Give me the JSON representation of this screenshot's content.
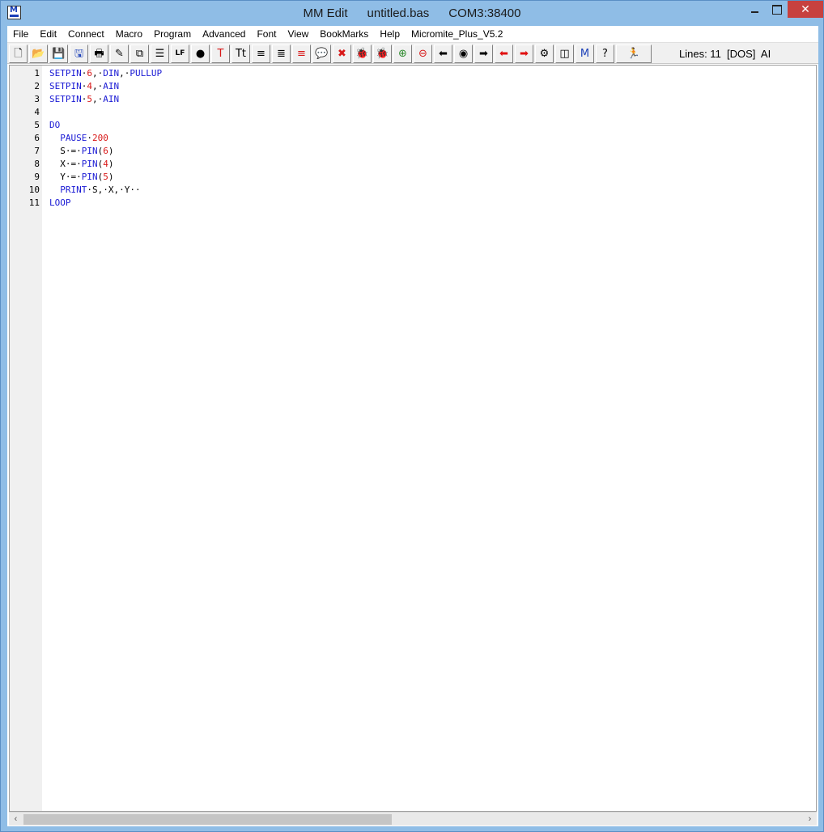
{
  "window": {
    "title_app": "MM Edit",
    "title_file": "untitled.bas",
    "title_port": "COM3:38400",
    "close_glyph": "✕"
  },
  "menu": [
    "File",
    "Edit",
    "Connect",
    "Macro",
    "Program",
    "Advanced",
    "Font",
    "View",
    "BookMarks",
    "Help",
    "Micromite_Plus_V5.2"
  ],
  "toolbar": {
    "buttons": [
      {
        "icon": "new-file-icon",
        "glyph": "🗋"
      },
      {
        "icon": "open-folder-icon",
        "glyph": "📂"
      },
      {
        "icon": "save-icon",
        "glyph": "💾"
      },
      {
        "icon": "save-as-icon",
        "glyph": "🖫"
      },
      {
        "icon": "print-icon",
        "glyph": "🖶"
      },
      {
        "icon": "highlighter-icon",
        "glyph": "✎"
      },
      {
        "icon": "copy-icon",
        "glyph": "⧉"
      },
      {
        "icon": "list-icon",
        "glyph": "☰"
      },
      {
        "icon": "lf-icon",
        "glyph": "LF"
      },
      {
        "icon": "dot-icon",
        "glyph": "●"
      },
      {
        "icon": "red-text-icon",
        "glyph": "T"
      },
      {
        "icon": "text-case-icon",
        "glyph": "Tt"
      },
      {
        "icon": "align-left-icon",
        "glyph": "≡"
      },
      {
        "icon": "align-right-icon",
        "glyph": "≣"
      },
      {
        "icon": "red-indent-icon",
        "glyph": "≡"
      },
      {
        "icon": "comment-bubble-icon",
        "glyph": "💬"
      },
      {
        "icon": "remove-comment-icon",
        "glyph": "✖"
      },
      {
        "icon": "bug-green-icon",
        "glyph": "🐞"
      },
      {
        "icon": "bug-red-icon",
        "glyph": "🐞"
      },
      {
        "icon": "add-bookmark-icon",
        "glyph": "⊕"
      },
      {
        "icon": "remove-bookmark-icon",
        "glyph": "⊖"
      },
      {
        "icon": "arrow-left-icon",
        "glyph": "⬅"
      },
      {
        "icon": "target-icon",
        "glyph": "◉"
      },
      {
        "icon": "arrow-right-icon",
        "glyph": "➡"
      },
      {
        "icon": "red-arrow-left-icon",
        "glyph": "⬅"
      },
      {
        "icon": "red-arrow-right-icon",
        "glyph": "➡"
      },
      {
        "icon": "gear-icon",
        "glyph": "⚙"
      },
      {
        "icon": "split-view-icon",
        "glyph": "◫"
      },
      {
        "icon": "mm-monitor-icon",
        "glyph": "M"
      },
      {
        "icon": "help-icon",
        "glyph": "?"
      },
      {
        "icon": "run-icon",
        "glyph": "🏃"
      }
    ],
    "status": "Lines: 11  [DOS]  AI"
  },
  "colors": {
    "keyword": "#1a1ad4",
    "number": "#d81818",
    "titlebar": "#8fbde6",
    "close_button": "#c7413f"
  },
  "editor": {
    "lines": [
      {
        "num": "1",
        "tokens": [
          [
            "kw",
            "SETPIN"
          ],
          [
            "plain",
            "·"
          ],
          [
            "num",
            "6"
          ],
          [
            "plain",
            ",·"
          ],
          [
            "kw",
            "DIN"
          ],
          [
            "plain",
            ",·"
          ],
          [
            "kw",
            "PULLUP"
          ]
        ]
      },
      {
        "num": "2",
        "tokens": [
          [
            "kw",
            "SETPIN"
          ],
          [
            "plain",
            "·"
          ],
          [
            "num",
            "4"
          ],
          [
            "plain",
            ",·"
          ],
          [
            "kw",
            "AIN"
          ]
        ]
      },
      {
        "num": "3",
        "tokens": [
          [
            "kw",
            "SETPIN"
          ],
          [
            "plain",
            "·"
          ],
          [
            "num",
            "5"
          ],
          [
            "plain",
            ",·"
          ],
          [
            "kw",
            "AIN"
          ]
        ]
      },
      {
        "num": "4",
        "tokens": []
      },
      {
        "num": "5",
        "tokens": [
          [
            "kw",
            "DO"
          ]
        ]
      },
      {
        "num": "6",
        "tokens": [
          [
            "plain",
            "  "
          ],
          [
            "kw",
            "PAUSE"
          ],
          [
            "plain",
            "·"
          ],
          [
            "num",
            "200"
          ]
        ]
      },
      {
        "num": "7",
        "tokens": [
          [
            "plain",
            "  S·=·"
          ],
          [
            "kw",
            "PIN"
          ],
          [
            "plain",
            "("
          ],
          [
            "num",
            "6"
          ],
          [
            "plain",
            ")"
          ]
        ]
      },
      {
        "num": "8",
        "tokens": [
          [
            "plain",
            "  X·=·"
          ],
          [
            "kw",
            "PIN"
          ],
          [
            "plain",
            "("
          ],
          [
            "num",
            "4"
          ],
          [
            "plain",
            ")"
          ]
        ]
      },
      {
        "num": "9",
        "tokens": [
          [
            "plain",
            "  Y·=·"
          ],
          [
            "kw",
            "PIN"
          ],
          [
            "plain",
            "("
          ],
          [
            "num",
            "5"
          ],
          [
            "plain",
            ")"
          ]
        ]
      },
      {
        "num": "10",
        "tokens": [
          [
            "plain",
            "  "
          ],
          [
            "kw",
            "PRINT"
          ],
          [
            "plain",
            "·S,·X,·Y··"
          ]
        ]
      },
      {
        "num": "11",
        "tokens": [
          [
            "kw",
            "LOOP"
          ]
        ]
      }
    ]
  },
  "scrollbar": {
    "left_arrow": "‹",
    "right_arrow": "›"
  }
}
